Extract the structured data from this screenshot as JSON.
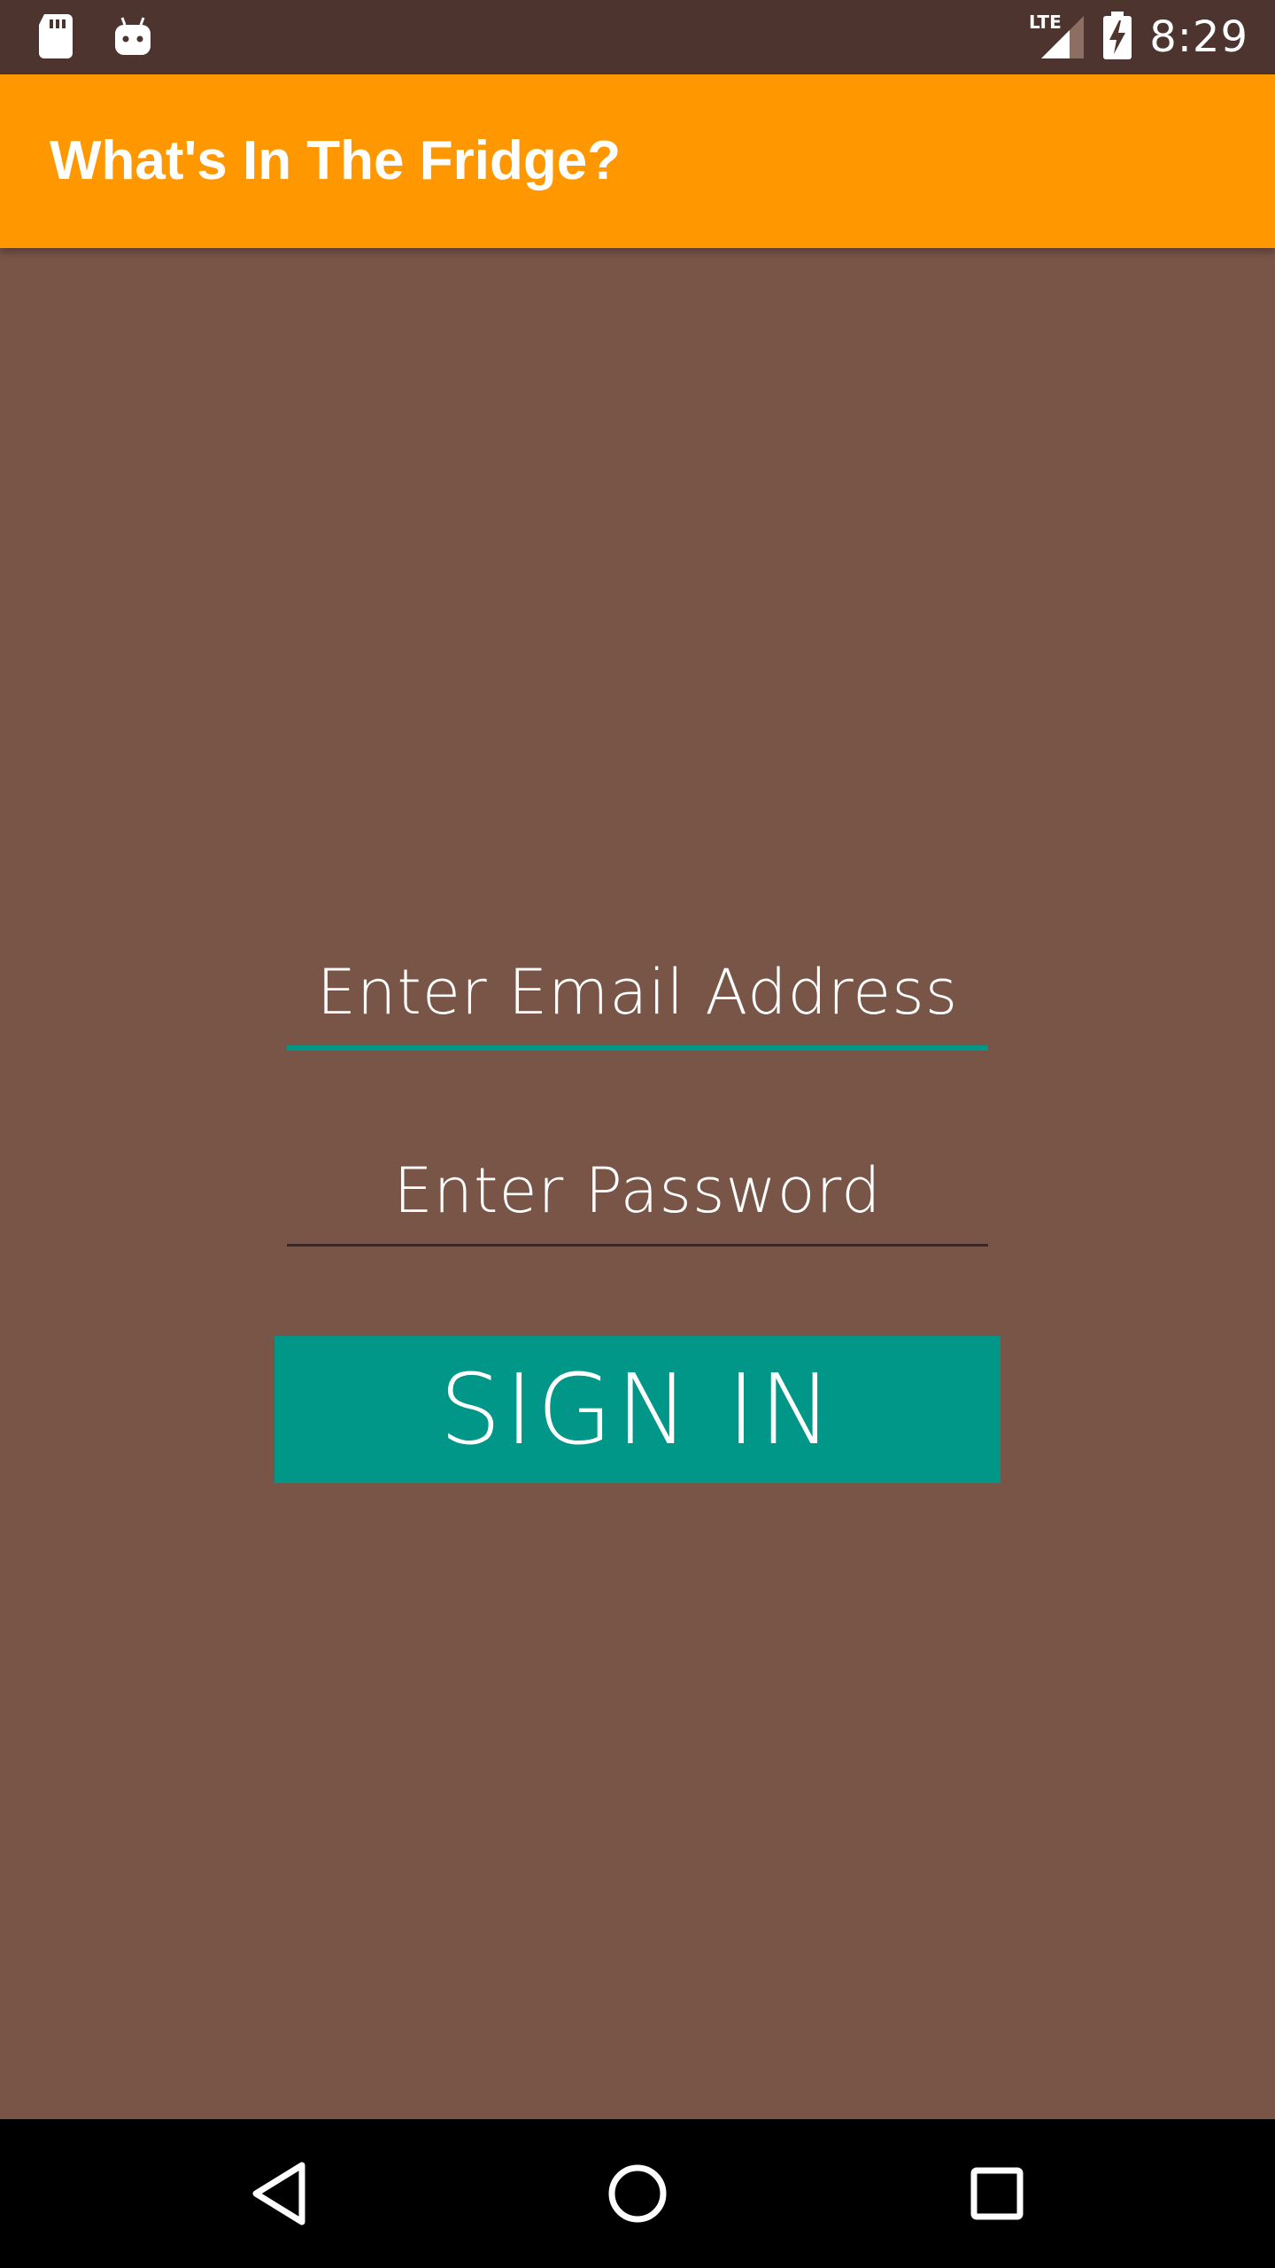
{
  "status_bar": {
    "time": "8:29",
    "network": "LTE",
    "icons": [
      "sd-card-icon",
      "android-icon",
      "signal-icon",
      "battery-charging-icon"
    ]
  },
  "app_bar": {
    "title": "What's In The Fridge?"
  },
  "form": {
    "email": {
      "value": "",
      "placeholder": "Enter Email Address"
    },
    "password": {
      "value": "",
      "placeholder": "Enter Password"
    },
    "submit_label": "SIGN IN"
  },
  "nav_bar": {
    "buttons": [
      "back-icon",
      "home-icon",
      "recents-icon"
    ]
  },
  "colors": {
    "status_bar": "#4e342e",
    "app_bar": "#ff9800",
    "background": "#795548",
    "accent": "#009688",
    "nav_bar": "#000000"
  }
}
